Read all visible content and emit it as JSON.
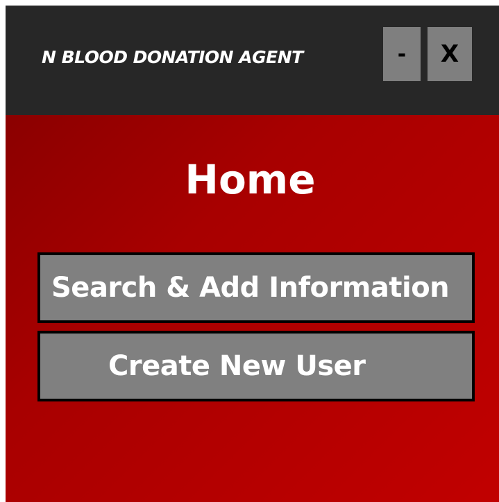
{
  "window": {
    "title": "N BLOOD DONATION AGENT",
    "minimize_label": "-",
    "close_label": "X"
  },
  "main": {
    "heading": "Home",
    "buttons": [
      {
        "label": "Search & Add Information"
      },
      {
        "label": "Create New User"
      }
    ]
  },
  "colors": {
    "titlebar": "#272727",
    "background_gradient_start": "#8b0000",
    "background_gradient_end": "#c10000",
    "button": "#808080",
    "button_border": "#000000",
    "text": "#ffffff"
  }
}
